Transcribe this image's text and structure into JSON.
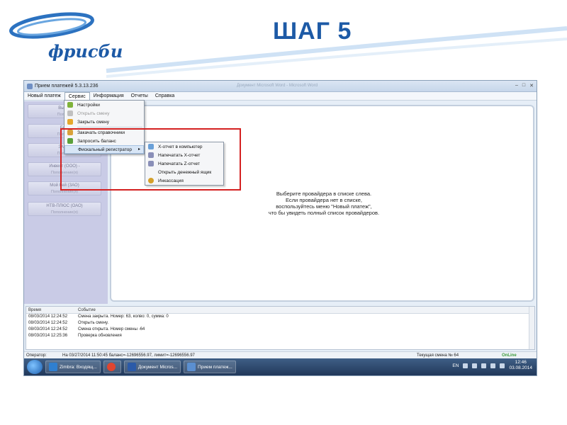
{
  "slide": {
    "logo_text": "фрисби",
    "title": "ШАГ 5"
  },
  "window": {
    "title": "Прием платежей 5.3.13.236",
    "faded_title": "Документ Microsoft Word - Microsoft Word",
    "controls": [
      "–",
      "□",
      "✕"
    ]
  },
  "menubar": [
    {
      "label": "Новый платеж"
    },
    {
      "label": "Сервис"
    },
    {
      "label": "Информация"
    },
    {
      "label": "Отчеты"
    },
    {
      "label": "Справка"
    }
  ],
  "providers": [
    {
      "name": "Вым...",
      "sub": "Попол..."
    },
    {
      "name": "Би...",
      "sub": "Попол..."
    },
    {
      "name": "ЗАО...",
      "sub": "Попол..."
    },
    {
      "name": "Инвест (ООО) -",
      "sub": "Пополнение(я)"
    },
    {
      "name": "Мой Кей (ЗАО)",
      "sub": "Пополнение(я)"
    },
    {
      "name": "НТВ-ПЛЮС (ОАО)",
      "sub": "Пополнение(я)"
    }
  ],
  "service_menu": [
    {
      "label": "Настройки",
      "icon_color": "#7fb23a",
      "disabled": false
    },
    {
      "label": "Открыть смену",
      "icon_color": "#c0c0c0",
      "disabled": true
    },
    {
      "label": "Закрыть смену",
      "icon_color": "#e5a82c",
      "disabled": false
    },
    {
      "label": "Закачать справочники",
      "icon_color": "#d9a13a",
      "disabled": false
    },
    {
      "label": "Запросить баланс",
      "icon_color": "#5aa03a",
      "disabled": false
    },
    {
      "label": "Фискальный регистратор",
      "icon_color": "",
      "disabled": false,
      "submenu": true
    }
  ],
  "fiscal_menu": [
    {
      "label": "X-отчет в компьютер",
      "icon_color": "#6aa0d8"
    },
    {
      "label": "Напечатать X-отчет",
      "icon_color": "#8a8fb8"
    },
    {
      "label": "Напечатать Z-отчет",
      "icon_color": "#8a8fb8"
    },
    {
      "label": "Открыть денежный ящик",
      "icon_color": ""
    },
    {
      "label": "Инкассация",
      "icon_color": "#d4a02a"
    }
  ],
  "hint": {
    "line1": "Выберите провайдера в списке слева.",
    "line2": "Если провайдера нет в списке,",
    "line3": "воспользуйтесь меню \"Новый платеж\",",
    "line4": "что бы увидеть полный список провайдеров."
  },
  "log": {
    "headers": {
      "time": "Время",
      "event": "Событие"
    },
    "rows": [
      {
        "time": "08/03/2014 12:24:52",
        "event": "Смена закрыта. Номер: 63, колвo: 0, сумма: 0"
      },
      {
        "time": "08/03/2014 12:24:52",
        "event": "Открыть смену."
      },
      {
        "time": "08/03/2014 12:24:52",
        "event": "Смена открыта. Номер смены -64"
      },
      {
        "time": "08/03/2014 12:25:36",
        "event": "Проверка обновления"
      }
    ]
  },
  "status": {
    "operator_label": "Оператор:",
    "balance": "На 03/27/2014 11:50:45 баланс=-12696556.97, лимит=-12696556.97",
    "shift": "Текущая смена № 64",
    "online": "OnLine"
  },
  "taskbar": {
    "items": [
      {
        "label": "Zimbra: Входящ...",
        "icon_color": "#2f7fd0"
      },
      {
        "label": "",
        "icon_color": "#e0452f"
      },
      {
        "label": "Документ Micros...",
        "icon_color": "#2b5aa8"
      },
      {
        "label": "Прием платеж...",
        "icon_color": "#5b8fd0"
      }
    ],
    "lang": "EN",
    "time": "12:46",
    "date": "03.08.2014"
  }
}
